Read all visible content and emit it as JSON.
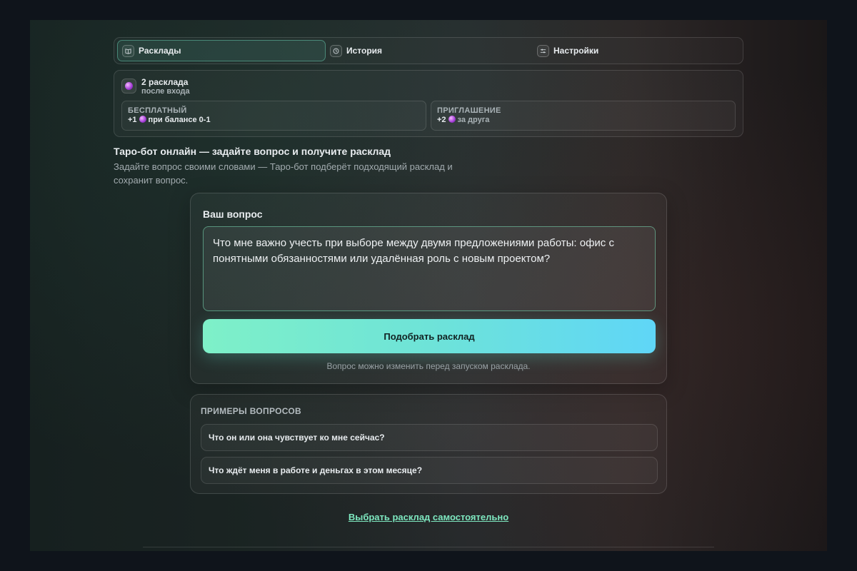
{
  "tabs": [
    {
      "label": "Расклады",
      "icon": "book-icon",
      "active": true
    },
    {
      "label": "История",
      "icon": "history-icon",
      "active": false
    },
    {
      "label": "Настройки",
      "icon": "settings-icon",
      "active": false
    }
  ],
  "balance": {
    "title": "2 расклада",
    "subtitle": "после входа",
    "icon": "crystal-ball-icon",
    "free": {
      "label": "БЕСПЛАТНЫЙ",
      "prefix": "+1",
      "suffix": "при балансе 0-1"
    },
    "invite": {
      "label": "ПРИГЛАШЕНИЕ",
      "prefix": "+2",
      "suffix": "за друга"
    }
  },
  "intro": {
    "title": "Таро-бот онлайн — задайте вопрос и получите расклад",
    "description": "Задайте вопрос своими словами — Таро-бот подберёт подходящий расклад и сохранит вопрос."
  },
  "question": {
    "label": "Ваш вопрос",
    "value": "Что мне важно учесть при выборе между двумя предложениями работы: офис с понятными обязанностями или удалённая роль с новым проектом?",
    "submit_label": "Подобрать расклад",
    "hint": "Вопрос можно изменить перед запуском расклада."
  },
  "examples": {
    "title": "ПРИМЕРЫ ВОПРОСОВ",
    "items": [
      "Что он или она чувствует ко мне сейчас?",
      "Что ждёт меня в работе и деньгах в этом месяце?"
    ]
  },
  "self_select_link": "Выбрать расклад самостоятельно",
  "colors": {
    "accent": "#7ee8c0",
    "button_gradient_start": "#7ef0c8",
    "button_gradient_end": "#5fd6f7"
  }
}
